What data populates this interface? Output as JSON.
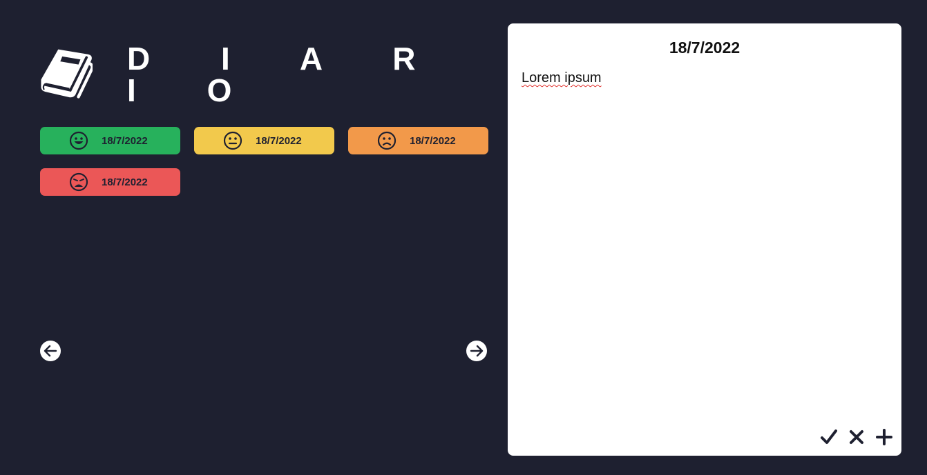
{
  "app": {
    "title": "D I A R I O",
    "logo_icon": "book-icon"
  },
  "entries": [
    {
      "mood": "happy",
      "icon": "grin-face-icon",
      "date": "18/7/2022",
      "color": "#27b15c"
    },
    {
      "mood": "neutral",
      "icon": "neutral-face-icon",
      "date": "18/7/2022",
      "color": "#f2c94c"
    },
    {
      "mood": "sad",
      "icon": "frown-face-icon",
      "date": "18/7/2022",
      "color": "#f2994a"
    },
    {
      "mood": "crying",
      "icon": "crying-face-icon",
      "date": "18/7/2022",
      "color": "#eb5757"
    }
  ],
  "navigation": {
    "prev_icon": "arrow-left-icon",
    "next_icon": "arrow-right-icon"
  },
  "editor": {
    "date": "18/7/2022",
    "text": "Lorem ipsum",
    "actions": {
      "save_icon": "check-icon",
      "delete_icon": "x-icon",
      "add_icon": "plus-icon"
    }
  },
  "colors": {
    "background": "#1e2030",
    "panel": "#ffffff",
    "text_dark": "#1e2030"
  }
}
